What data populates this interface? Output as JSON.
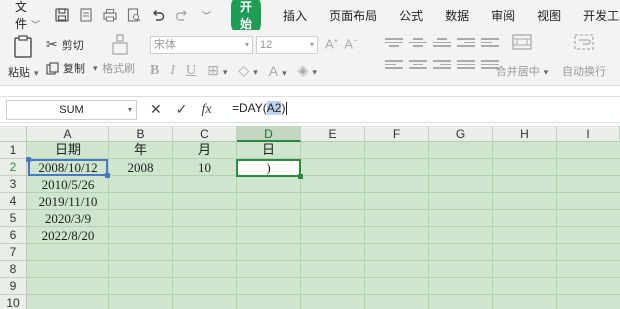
{
  "menubar": {
    "file": "文件",
    "start": "开始",
    "tabs": [
      "插入",
      "页面布局",
      "公式",
      "数据",
      "审阅",
      "视图",
      "开发工具"
    ]
  },
  "ribbon": {
    "paste": "粘贴",
    "cut": "剪切",
    "copy": "复制",
    "format_painter": "格式刷",
    "font_name": "宋体",
    "font_size": "12",
    "merge": "合并居中",
    "wrap": "自动换行"
  },
  "formula_bar": {
    "name_box": "SUM",
    "formula_prefix": "=DAY(",
    "formula_ref": "A2",
    "formula_suffix": ")"
  },
  "sheet": {
    "columns": [
      "A",
      "B",
      "C",
      "D",
      "E",
      "F",
      "G",
      "H",
      "I"
    ],
    "selected_column": "D",
    "rows": [
      "1",
      "2",
      "3",
      "4",
      "5",
      "6",
      "7",
      "8",
      "9",
      "10"
    ],
    "selected_row": "2",
    "headers": {
      "A1": "日期",
      "B1": "年",
      "C1": "月",
      "D1": "日"
    },
    "cells": {
      "A2": "2008/10/12",
      "B2": "2008",
      "C2": "10",
      "D2": ")",
      "A3": "2010/5/26",
      "A4": "2019/11/10",
      "A5": "2020/3/9",
      "A6": "2022/8/20"
    }
  },
  "colors": {
    "accent": "#1f9d55",
    "sheet_bg": "#cde6cd",
    "ref_highlight": "#4a78c8"
  }
}
